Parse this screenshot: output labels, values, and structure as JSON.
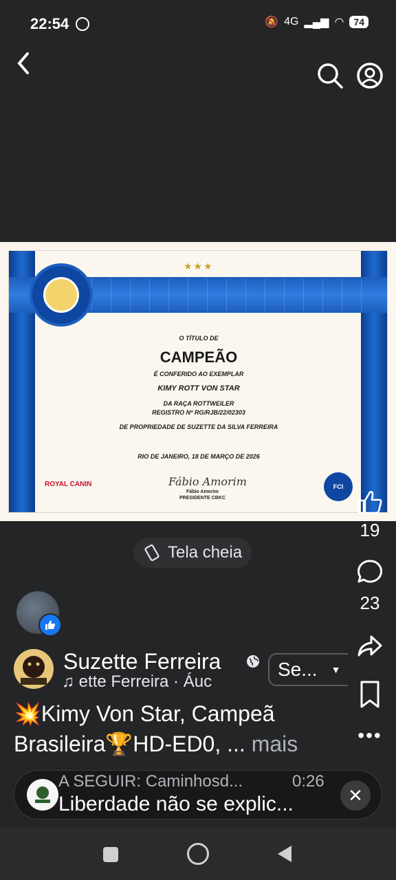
{
  "status_bar": {
    "time": "22:54",
    "network": "4G",
    "battery": "74"
  },
  "certificate": {
    "stars": "★★★",
    "line1": "O TÍTULO DE",
    "line2": "CAMPEÃO",
    "line3": "É CONFERIDO AO EXEMPLAR",
    "line4": "KIMY ROTT VON STAR",
    "line5": "DA RAÇA ROTTWEILER",
    "line6": "REGISTRO Nº RG/RJB/22/02303",
    "line7": "DE PROPRIEDADE DE SUZETTE DA SILVA FERREIRA",
    "line8": "RIO DE JANEIRO, 18 DE MARÇO DE 2026",
    "sponsor": "ROYAL CANIN",
    "signature": "Fábio Amorim",
    "signer_name": "Fábio Amorim",
    "signer_title": "PRESIDENTE CBKC",
    "fci": "FCI"
  },
  "rail": {
    "likes": "19",
    "comments": "23"
  },
  "fullscreen": {
    "label": "Tela cheia"
  },
  "post": {
    "author": "Suzette Ferreira",
    "audio": "ette Ferreira · Áuc",
    "follow_label": "Se...",
    "caption_line1": "💥Kimy Von Star, Campeã",
    "caption_line2": "Brasileira🏆HD-ED0, ...",
    "caption_more": "mais"
  },
  "up_next": {
    "label": "A SEGUIR: Caminhosd...",
    "duration": "0:26",
    "title": "Liberdade não se explic..."
  }
}
